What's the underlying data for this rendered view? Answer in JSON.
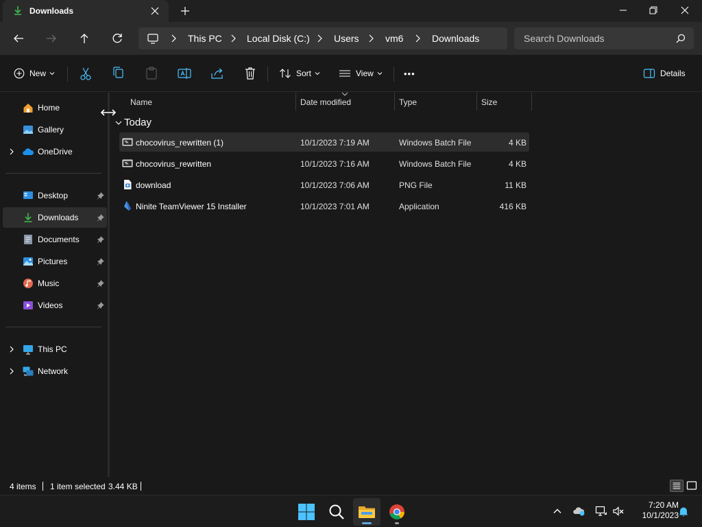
{
  "window": {
    "tab_title": "Downloads",
    "new_tab": "+"
  },
  "nav": {
    "breadcrumb": [
      "This PC",
      "Local Disk (C:)",
      "Users",
      "vm6",
      "Downloads"
    ],
    "search_placeholder": "Search Downloads"
  },
  "commands": {
    "new_label": "New",
    "sort_label": "Sort",
    "view_label": "View",
    "more_label": "•••",
    "details_label": "Details"
  },
  "sidebar": {
    "items": [
      {
        "label": "Home",
        "icon": "home-icon",
        "expandable": false,
        "pinned": false
      },
      {
        "label": "Gallery",
        "icon": "gallery-icon",
        "expandable": false,
        "pinned": false
      },
      {
        "label": "OneDrive",
        "icon": "onedrive-icon",
        "expandable": true,
        "pinned": false
      },
      {
        "label": "Desktop",
        "icon": "desktop-icon",
        "expandable": false,
        "pinned": true
      },
      {
        "label": "Downloads",
        "icon": "downloads-icon",
        "expandable": false,
        "pinned": true,
        "selected": true
      },
      {
        "label": "Documents",
        "icon": "documents-icon",
        "expandable": false,
        "pinned": true
      },
      {
        "label": "Pictures",
        "icon": "pictures-icon",
        "expandable": false,
        "pinned": true
      },
      {
        "label": "Music",
        "icon": "music-icon",
        "expandable": false,
        "pinned": true
      },
      {
        "label": "Videos",
        "icon": "videos-icon",
        "expandable": false,
        "pinned": true
      },
      {
        "label": "This PC",
        "icon": "this-pc-icon",
        "expandable": true,
        "pinned": false
      },
      {
        "label": "Network",
        "icon": "network-icon",
        "expandable": true,
        "pinned": false
      }
    ]
  },
  "columns": {
    "name": "Name",
    "date": "Date modified",
    "type": "Type",
    "size": "Size"
  },
  "group": {
    "label": "Today"
  },
  "files": [
    {
      "name": "chocovirus_rewritten (1)",
      "date": "10/1/2023 7:19 AM",
      "type": "Windows Batch File",
      "size": "4 KB",
      "icon": "batch-file-icon",
      "selected": true
    },
    {
      "name": "chocovirus_rewritten",
      "date": "10/1/2023 7:16 AM",
      "type": "Windows Batch File",
      "size": "4 KB",
      "icon": "batch-file-icon",
      "selected": false
    },
    {
      "name": "download",
      "date": "10/1/2023 7:06 AM",
      "type": "PNG File",
      "size": "11 KB",
      "icon": "png-file-icon",
      "selected": false
    },
    {
      "name": "Ninite TeamViewer 15 Installer",
      "date": "10/1/2023 7:01 AM",
      "type": "Application",
      "size": "416 KB",
      "icon": "ninite-app-icon",
      "selected": false
    }
  ],
  "status": {
    "item_count": "4 items",
    "selection": "1 item selected",
    "selection_size": "3.44 KB"
  },
  "taskbar": {
    "time": "7:20 AM",
    "date": "10/1/2023"
  },
  "colors": {
    "accent": "#4cc2ff",
    "downloads_green": "#3fb950",
    "folder_yellow": "#ffc83d",
    "window_bg": "#191919"
  }
}
